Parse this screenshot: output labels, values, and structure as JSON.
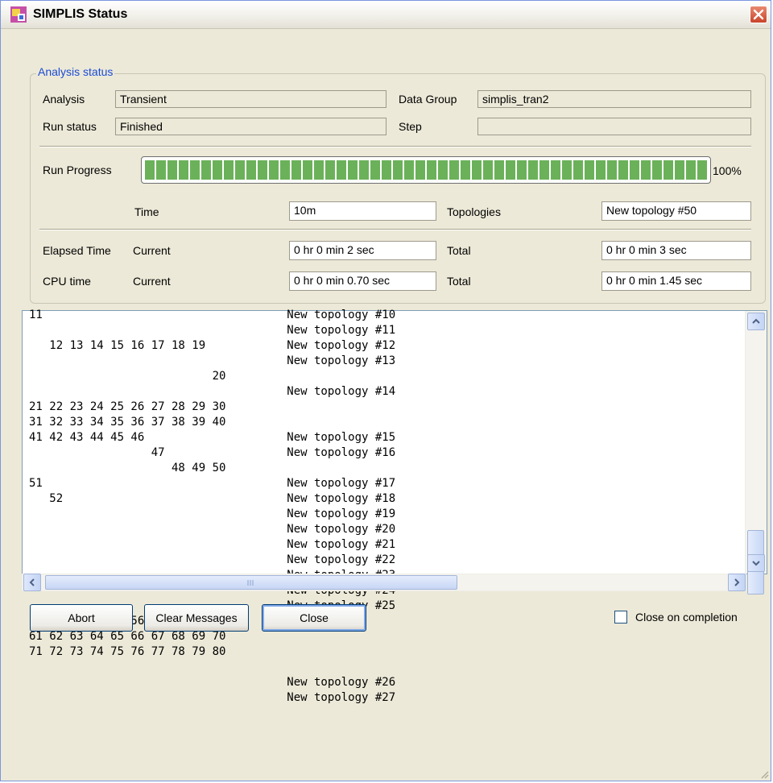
{
  "window": {
    "title": "SIMPLIS Status"
  },
  "analysis_status": {
    "group_title": "Analysis status",
    "analysis_label": "Analysis",
    "analysis_value": "Transient",
    "data_group_label": "Data Group",
    "data_group_value": "simplis_tran2",
    "run_status_label": "Run status",
    "run_status_value": "Finished",
    "step_label": "Step",
    "step_value": "",
    "run_progress_label": "Run Progress",
    "progress_percent": 100,
    "progress_text": "100%",
    "time_label": "Time",
    "time_value": "10m",
    "topologies_label": "Topologies",
    "topologies_value": "New topology #50",
    "elapsed_label": "Elapsed Time",
    "elapsed_current_label": "Current",
    "elapsed_current_value": "0 hr  0 min  2   sec",
    "elapsed_total_label": "Total",
    "elapsed_total_value": "0 hr  0 min  3   sec",
    "cpu_label": "CPU time",
    "cpu_current_label": "Current",
    "cpu_current_value": "0 hr  0 min  0.70 sec",
    "cpu_total_label": "Total",
    "cpu_total_value": "0 hr  0 min  1.45 sec"
  },
  "log": {
    "text": "11                                    New topology #10\n                                      New topology #11\n   12 13 14 15 16 17 18 19            New topology #12\n                                      New topology #13\n                           20\n                                      New topology #14\n21 22 23 24 25 26 27 28 29 30\n31 32 33 34 35 36 37 38 39 40\n41 42 43 44 45 46                     New topology #15\n                  47                  New topology #16\n                     48 49 50\n51                                    New topology #17\n   52                                 New topology #18\n                                      New topology #19\n                                      New topology #20\n                                      New topology #21\n                                      New topology #22\n                                      New topology #23\n                                      New topology #24\n                                      New topology #25\n      53 54 55 56 57 58 59 60\n61 62 63 64 65 66 67 68 69 70\n71 72 73 74 75 76 77 78 79 80\n\n                                      New topology #26\n                                      New topology #27"
  },
  "buttons": {
    "abort": "Abort",
    "clear_messages": "Clear Messages",
    "close": "Close"
  },
  "close_on_completion": {
    "label": "Close on completion",
    "checked": false
  },
  "icons": {
    "app": "simplis-app-icon",
    "close": "close-icon",
    "scroll_up": "chevron-up-icon",
    "scroll_down": "chevron-down-icon",
    "scroll_left": "chevron-left-icon",
    "scroll_right": "chevron-right-icon",
    "grip": "resize-grip-icon"
  },
  "colors": {
    "accent": "#1b4bd6",
    "progress": "#6bb15a",
    "close_button": "#c9432a"
  }
}
